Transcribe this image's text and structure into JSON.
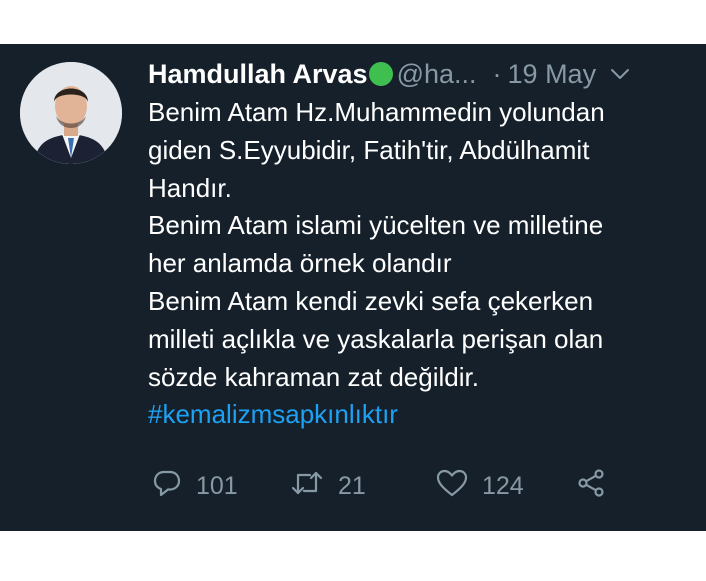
{
  "user": {
    "name": "Hamdullah Arvas",
    "handle": "@ha...",
    "dot": "·",
    "date": "19 May"
  },
  "tweet": {
    "lines": [
      "Benim Atam Hz.Muhammedin yolundan",
      "giden S.Eyyubidir, Fatih'tir, Abdülhamit",
      "Handır.",
      "Benim Atam islami yücelten ve milletine",
      "her anlamda örnek olandır",
      "Benim Atam kendi zevki sefa çekerken",
      "milleti açlıkla ve yaskalarla perişan olan",
      "sözde kahraman zat değildir."
    ],
    "hashtag": "#kemalizmsapkınlıktır"
  },
  "actions": {
    "replies": "101",
    "retweets": "21",
    "likes": "124"
  },
  "icons": {
    "reply": "reply-icon",
    "retweet": "retweet-icon",
    "like": "heart-icon",
    "share": "share-icon",
    "menu": "chevron-down-icon",
    "verified": "verified-badge-icon"
  },
  "colors": {
    "background": "#15202b",
    "text": "#ffffff",
    "secondary": "#8899a6",
    "link": "#1da1f2",
    "badge": "#3fbf4f"
  }
}
